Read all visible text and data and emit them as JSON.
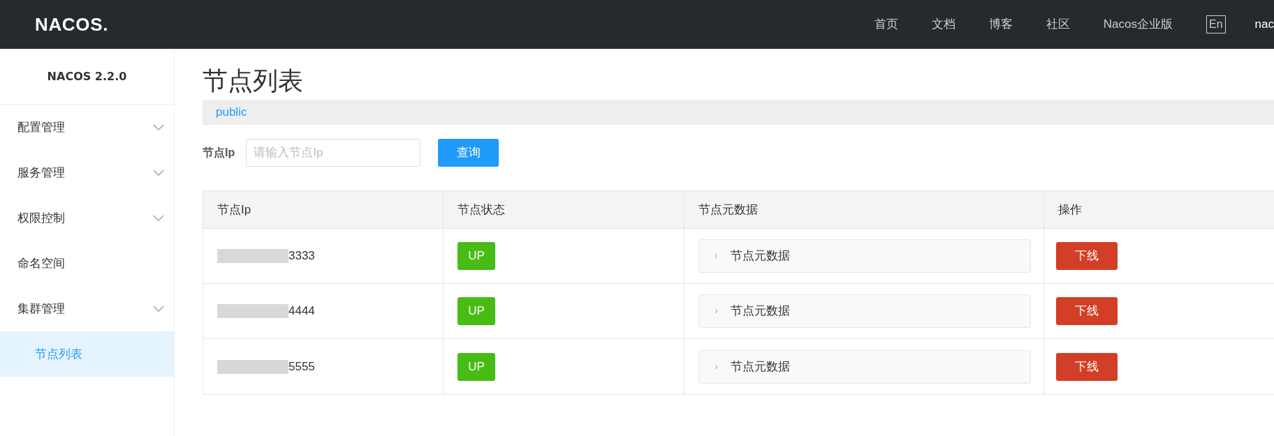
{
  "header": {
    "logo": "NACOS.",
    "nav": [
      "首页",
      "文档",
      "博客",
      "社区",
      "Nacos企业版"
    ],
    "language": "En",
    "user": "nac"
  },
  "sidebar": {
    "version": "NACOS 2.2.0",
    "items": [
      {
        "label": "配置管理",
        "kind": "group",
        "selected": false
      },
      {
        "label": "服务管理",
        "kind": "group",
        "selected": false
      },
      {
        "label": "权限控制",
        "kind": "group",
        "selected": false
      },
      {
        "label": "命名空间",
        "kind": "link",
        "selected": false
      },
      {
        "label": "集群管理",
        "kind": "group",
        "expanded": true,
        "selected": false,
        "children": [
          {
            "label": "节点列表",
            "selected": true
          }
        ]
      }
    ]
  },
  "page": {
    "title": "节点列表",
    "namespace": "public",
    "search": {
      "label": "节点Ip",
      "placeholder": "请输入节点Ip",
      "button": "查询"
    }
  },
  "table": {
    "columns": [
      "节点Ip",
      "节点状态",
      "节点元数据",
      "操作"
    ],
    "rows": [
      {
        "ip": "3333",
        "state": "UP",
        "metadata": "节点元数据",
        "action": "下线"
      },
      {
        "ip": "4444",
        "state": "UP",
        "metadata": "节点元数据",
        "action": "下线"
      },
      {
        "ip": "5555",
        "state": "UP",
        "metadata": "节点元数据",
        "action": "下线"
      }
    ]
  }
}
